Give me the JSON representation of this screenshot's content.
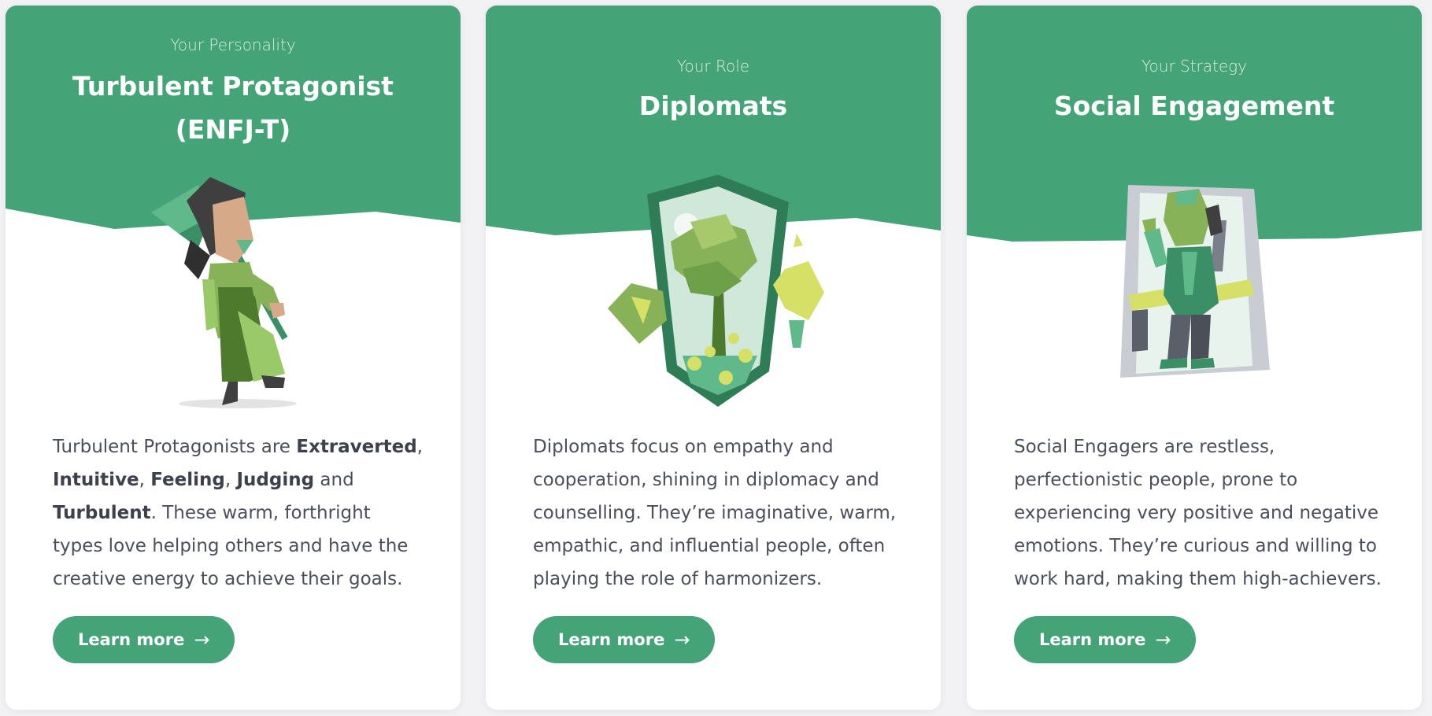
{
  "colors": {
    "accent": "#44a477",
    "card_bg": "#ffffff",
    "text": "#4b4f5c"
  },
  "cards": [
    {
      "subtitle": "Your Personality",
      "title_line1": "Turbulent Protagonist",
      "title_line2": "(ENFJ-T)",
      "desc_parts": [
        "Turbulent Protagonists are ",
        "Extraverted",
        ", ",
        "Intuitive",
        ", ",
        "Feeling",
        ", ",
        "Judging",
        " and ",
        "Turbulent",
        ". These warm, forthright types love helping others and have the creative energy to achieve their goals."
      ],
      "button_label": "Learn more",
      "button_icon": "arrow-right-icon",
      "illustration": "protagonist-character-illustration"
    },
    {
      "subtitle": "Your Role",
      "title": "Diplomats",
      "description": "Diplomats focus on empathy and cooperation, shining in diplomacy and counselling. They’re imaginative, warm, empathic, and influential people, often playing the role of harmonizers.",
      "button_label": "Learn more",
      "button_icon": "arrow-right-icon",
      "illustration": "diplomats-shield-illustration"
    },
    {
      "subtitle": "Your Strategy",
      "title": "Social Engagement",
      "description": "Social Engagers are restless, perfectionistic people, prone to experiencing very positive and negative emotions. They’re curious and willing to work hard, making them high-achievers.",
      "button_label": "Learn more",
      "button_icon": "arrow-right-icon",
      "illustration": "social-engagement-phone-illustration"
    }
  ],
  "arrow_glyph": "→"
}
